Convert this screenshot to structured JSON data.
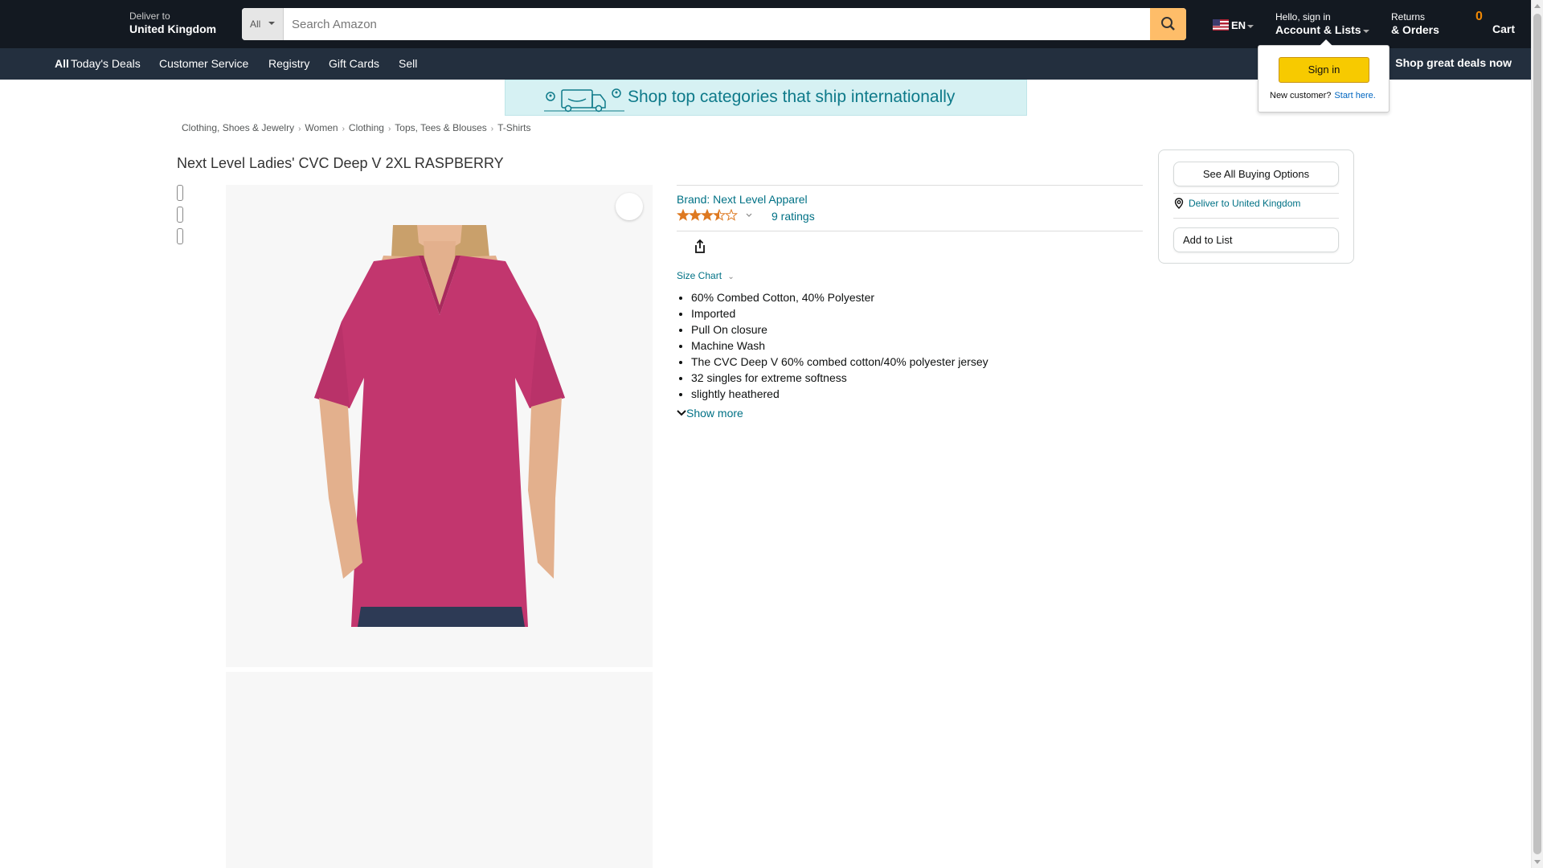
{
  "header": {
    "deliver_line1": "Deliver to",
    "deliver_line2": "United Kingdom",
    "search_category": "All",
    "search_placeholder": "Search Amazon",
    "language": "EN",
    "account_line1": "Hello, sign in",
    "account_line2": "Account & Lists",
    "returns_line1": "Returns",
    "returns_line2": "& Orders",
    "cart_count": "0",
    "cart_label": "Cart"
  },
  "nav": {
    "all": "All",
    "items": [
      "Today's Deals",
      "Customer Service",
      "Registry",
      "Gift Cards",
      "Sell"
    ],
    "promo": "Shop great deals now"
  },
  "flyout": {
    "signin": "Sign in",
    "new_customer": "New customer?",
    "start_here": "Start here."
  },
  "banner": {
    "text": "Shop top categories that ship internationally"
  },
  "breadcrumb": [
    "Clothing, Shoes & Jewelry",
    "Women",
    "Clothing",
    "Tops, Tees & Blouses",
    "T-Shirts"
  ],
  "product": {
    "title": "Next Level Ladies' CVC Deep V 2XL RASPBERRY",
    "brand": "Brand: Next Level Apparel",
    "rating_stars": 3.5,
    "ratings": "9 ratings",
    "size_chart": "Size Chart",
    "bullets": [
      "60% Combed Cotton, 40% Polyester",
      "Imported",
      "Pull On closure",
      "Machine Wash",
      "The CVC Deep V 60% combed cotton/40% polyester jersey",
      "32 singles for extreme softness",
      "slightly heathered"
    ],
    "show_more": "Show more"
  },
  "buybox": {
    "see_all": "See All Buying Options",
    "deliver_to": "Deliver to United Kingdom",
    "add_to_list": "Add to List"
  },
  "colors": {
    "nav_dark": "#131921",
    "nav_secondary": "#232f3e",
    "search_button": "#febd69",
    "link": "#007185",
    "star": "#de7921",
    "signin_button": "#f7ca00",
    "shirt": "#c2366e"
  }
}
